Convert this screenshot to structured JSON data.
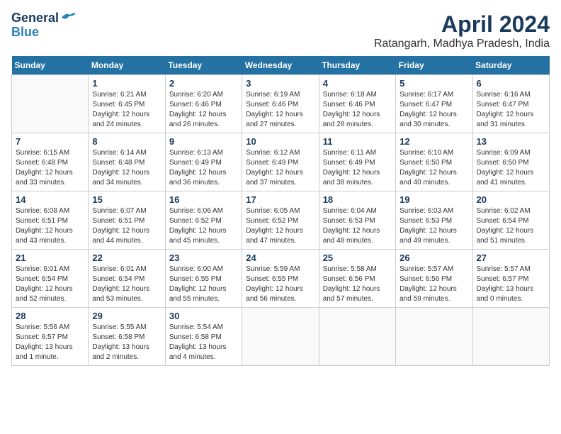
{
  "header": {
    "logo_line1": "General",
    "logo_line2": "Blue",
    "month_title": "April 2024",
    "location": "Ratangarh, Madhya Pradesh, India"
  },
  "days_of_week": [
    "Sunday",
    "Monday",
    "Tuesday",
    "Wednesday",
    "Thursday",
    "Friday",
    "Saturday"
  ],
  "weeks": [
    [
      {
        "day": "",
        "info": ""
      },
      {
        "day": "1",
        "info": "Sunrise: 6:21 AM\nSunset: 6:45 PM\nDaylight: 12 hours\nand 24 minutes."
      },
      {
        "day": "2",
        "info": "Sunrise: 6:20 AM\nSunset: 6:46 PM\nDaylight: 12 hours\nand 26 minutes."
      },
      {
        "day": "3",
        "info": "Sunrise: 6:19 AM\nSunset: 6:46 PM\nDaylight: 12 hours\nand 27 minutes."
      },
      {
        "day": "4",
        "info": "Sunrise: 6:18 AM\nSunset: 6:46 PM\nDaylight: 12 hours\nand 28 minutes."
      },
      {
        "day": "5",
        "info": "Sunrise: 6:17 AM\nSunset: 6:47 PM\nDaylight: 12 hours\nand 30 minutes."
      },
      {
        "day": "6",
        "info": "Sunrise: 6:16 AM\nSunset: 6:47 PM\nDaylight: 12 hours\nand 31 minutes."
      }
    ],
    [
      {
        "day": "7",
        "info": "Sunrise: 6:15 AM\nSunset: 6:48 PM\nDaylight: 12 hours\nand 33 minutes."
      },
      {
        "day": "8",
        "info": "Sunrise: 6:14 AM\nSunset: 6:48 PM\nDaylight: 12 hours\nand 34 minutes."
      },
      {
        "day": "9",
        "info": "Sunrise: 6:13 AM\nSunset: 6:49 PM\nDaylight: 12 hours\nand 36 minutes."
      },
      {
        "day": "10",
        "info": "Sunrise: 6:12 AM\nSunset: 6:49 PM\nDaylight: 12 hours\nand 37 minutes."
      },
      {
        "day": "11",
        "info": "Sunrise: 6:11 AM\nSunset: 6:49 PM\nDaylight: 12 hours\nand 38 minutes."
      },
      {
        "day": "12",
        "info": "Sunrise: 6:10 AM\nSunset: 6:50 PM\nDaylight: 12 hours\nand 40 minutes."
      },
      {
        "day": "13",
        "info": "Sunrise: 6:09 AM\nSunset: 6:50 PM\nDaylight: 12 hours\nand 41 minutes."
      }
    ],
    [
      {
        "day": "14",
        "info": "Sunrise: 6:08 AM\nSunset: 6:51 PM\nDaylight: 12 hours\nand 43 minutes."
      },
      {
        "day": "15",
        "info": "Sunrise: 6:07 AM\nSunset: 6:51 PM\nDaylight: 12 hours\nand 44 minutes."
      },
      {
        "day": "16",
        "info": "Sunrise: 6:06 AM\nSunset: 6:52 PM\nDaylight: 12 hours\nand 45 minutes."
      },
      {
        "day": "17",
        "info": "Sunrise: 6:05 AM\nSunset: 6:52 PM\nDaylight: 12 hours\nand 47 minutes."
      },
      {
        "day": "18",
        "info": "Sunrise: 6:04 AM\nSunset: 6:53 PM\nDaylight: 12 hours\nand 48 minutes."
      },
      {
        "day": "19",
        "info": "Sunrise: 6:03 AM\nSunset: 6:53 PM\nDaylight: 12 hours\nand 49 minutes."
      },
      {
        "day": "20",
        "info": "Sunrise: 6:02 AM\nSunset: 6:54 PM\nDaylight: 12 hours\nand 51 minutes."
      }
    ],
    [
      {
        "day": "21",
        "info": "Sunrise: 6:01 AM\nSunset: 6:54 PM\nDaylight: 12 hours\nand 52 minutes."
      },
      {
        "day": "22",
        "info": "Sunrise: 6:01 AM\nSunset: 6:54 PM\nDaylight: 12 hours\nand 53 minutes."
      },
      {
        "day": "23",
        "info": "Sunrise: 6:00 AM\nSunset: 6:55 PM\nDaylight: 12 hours\nand 55 minutes."
      },
      {
        "day": "24",
        "info": "Sunrise: 5:59 AM\nSunset: 6:55 PM\nDaylight: 12 hours\nand 56 minutes."
      },
      {
        "day": "25",
        "info": "Sunrise: 5:58 AM\nSunset: 6:56 PM\nDaylight: 12 hours\nand 57 minutes."
      },
      {
        "day": "26",
        "info": "Sunrise: 5:57 AM\nSunset: 6:56 PM\nDaylight: 12 hours\nand 59 minutes."
      },
      {
        "day": "27",
        "info": "Sunrise: 5:57 AM\nSunset: 6:57 PM\nDaylight: 13 hours\nand 0 minutes."
      }
    ],
    [
      {
        "day": "28",
        "info": "Sunrise: 5:56 AM\nSunset: 6:57 PM\nDaylight: 13 hours\nand 1 minute."
      },
      {
        "day": "29",
        "info": "Sunrise: 5:55 AM\nSunset: 6:58 PM\nDaylight: 13 hours\nand 2 minutes."
      },
      {
        "day": "30",
        "info": "Sunrise: 5:54 AM\nSunset: 6:58 PM\nDaylight: 13 hours\nand 4 minutes."
      },
      {
        "day": "",
        "info": ""
      },
      {
        "day": "",
        "info": ""
      },
      {
        "day": "",
        "info": ""
      },
      {
        "day": "",
        "info": ""
      }
    ]
  ]
}
